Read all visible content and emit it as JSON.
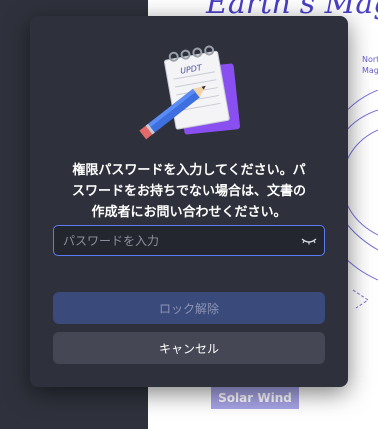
{
  "background_document": {
    "title": "Earth's Mag",
    "side_labels": [
      "Nort",
      "Mag"
    ],
    "solar_wind_label": "Solar Wind"
  },
  "dialog": {
    "message_lines": [
      "権限パスワードを入力してください。パ",
      "スワードをお持ちでない場合は、文書の",
      "作成者にお問い合わせください。"
    ],
    "notepad_text": "UPDT",
    "password": {
      "value": "",
      "placeholder": "パスワードを入力"
    },
    "unlock_label": "ロック解除",
    "cancel_label": "キャンセル"
  },
  "colors": {
    "dialog_bg": "#2e313b",
    "accent_border": "#5b7cf0",
    "unlock_bg": "#3a4a7a",
    "cancel_bg": "#454854"
  }
}
